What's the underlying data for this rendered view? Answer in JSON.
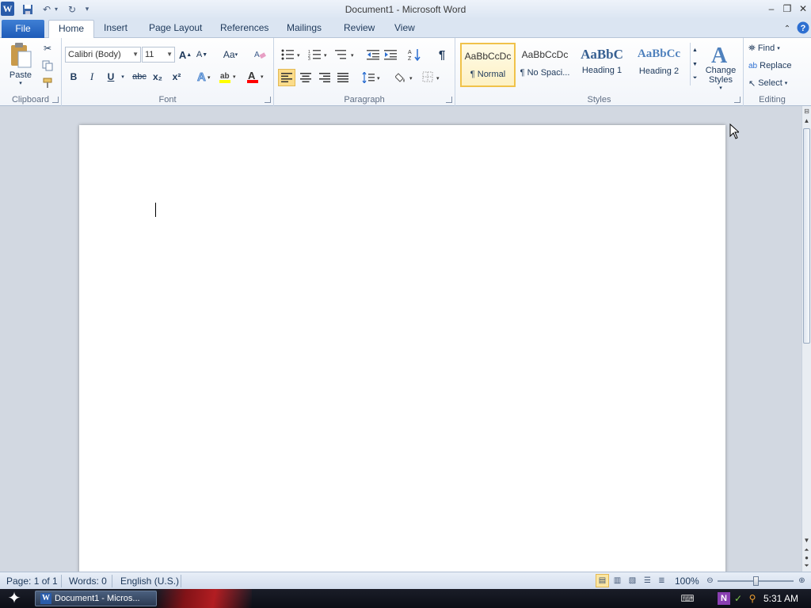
{
  "window": {
    "title": "Document1 - Microsoft Word",
    "app_logo": "W"
  },
  "tabs": {
    "file": "File",
    "items": [
      "Home",
      "Insert",
      "Page Layout",
      "References",
      "Mailings",
      "Review",
      "View"
    ],
    "active": "Home"
  },
  "ribbon": {
    "clipboard": {
      "label": "Clipboard",
      "paste": "Paste"
    },
    "font": {
      "label": "Font",
      "font_name": "Calibri (Body)",
      "font_size": "11",
      "bold": "B",
      "italic": "I",
      "underline": "U",
      "strike": "abc",
      "subscript": "x₂",
      "superscript": "x²",
      "change_case": "Aa",
      "grow": "A",
      "shrink": "A",
      "font_color_glyph": "A"
    },
    "paragraph": {
      "label": "Paragraph",
      "pilcrow": "¶"
    },
    "styles": {
      "label": "Styles",
      "items": [
        {
          "sample": "AaBbCcDc",
          "name": "¶ Normal",
          "selected": true
        },
        {
          "sample": "AaBbCcDc",
          "name": "¶ No Spaci...",
          "selected": false
        },
        {
          "sample": "AaBbC",
          "name": "Heading 1",
          "selected": false
        },
        {
          "sample": "AaBbCc",
          "name": "Heading 2",
          "selected": false
        }
      ],
      "change_styles": "Change Styles"
    },
    "editing": {
      "label": "Editing",
      "find": "Find",
      "replace": "Replace",
      "select": "Select"
    }
  },
  "status": {
    "page": "Page: 1 of 1",
    "words": "Words: 0",
    "language": "English (U.S.)",
    "zoom": "100%",
    "zoom_level": 100
  },
  "taskbar": {
    "task_label": "Document1 - Micros...",
    "clock": "5:31 AM"
  },
  "colors": {
    "file_tab": "#1e5bb8",
    "highlight": "#ffff00",
    "font_color": "#ff0000",
    "selected_style": "#f0c24a"
  }
}
